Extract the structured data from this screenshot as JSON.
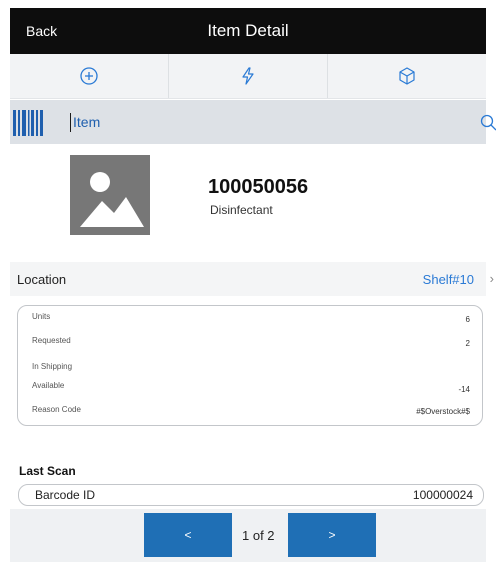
{
  "header": {
    "back_label": "Back",
    "title": "Item Detail"
  },
  "toolbar": {
    "items": [
      {
        "icon": "plus-circle-icon"
      },
      {
        "icon": "lightning-icon"
      },
      {
        "icon": "cube-icon"
      }
    ]
  },
  "search": {
    "value": "Item"
  },
  "item": {
    "number": "100050056",
    "description": "Disinfectant"
  },
  "location": {
    "label": "Location",
    "value": "Shelf#10"
  },
  "details": [
    {
      "label": "Units",
      "value": "6"
    },
    {
      "label": "Requested",
      "value": "2"
    },
    {
      "label": "In Shipping",
      "value": ""
    },
    {
      "label": "Available",
      "value": "-14"
    },
    {
      "label": "Reason Code",
      "value": "#$Overstock#$"
    }
  ],
  "last_scan": {
    "title": "Last Scan",
    "label": "Barcode ID",
    "value": "100000024"
  },
  "pager": {
    "prev_label": "<",
    "next_label": ">",
    "indicator": "1 of 2"
  },
  "colors": {
    "header_bg": "#0d0d0d",
    "accent_blue": "#2a7ad5",
    "button_blue": "#1f6fb5"
  }
}
